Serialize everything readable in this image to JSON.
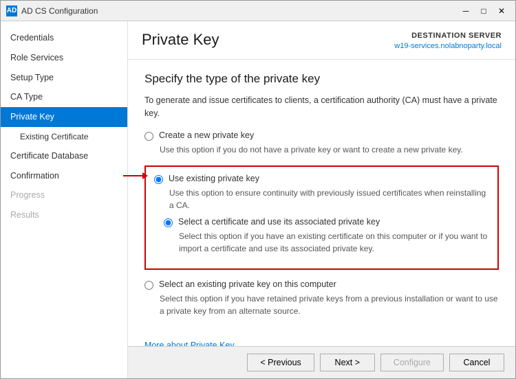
{
  "window": {
    "title": "AD CS Configuration",
    "icon": "AD"
  },
  "titlebar_controls": {
    "minimize": "─",
    "maximize": "□",
    "close": "✕"
  },
  "header": {
    "page_title": "Private Key",
    "destination_label": "DESTINATION SERVER",
    "server_name": "w19-services.nolabnoparty.local"
  },
  "sidebar": {
    "items": [
      {
        "label": "Credentials",
        "state": "normal"
      },
      {
        "label": "Role Services",
        "state": "normal"
      },
      {
        "label": "Setup Type",
        "state": "normal"
      },
      {
        "label": "CA Type",
        "state": "normal"
      },
      {
        "label": "Private Key",
        "state": "active"
      },
      {
        "label": "Existing Certificate",
        "state": "sub"
      },
      {
        "label": "Certificate Database",
        "state": "normal"
      },
      {
        "label": "Confirmation",
        "state": "normal"
      },
      {
        "label": "Progress",
        "state": "disabled"
      },
      {
        "label": "Results",
        "state": "disabled"
      }
    ]
  },
  "content": {
    "section_title": "Specify the type of the private key",
    "intro_text": "To generate and issue certificates to clients, a certification authority (CA) must have a private key.",
    "options": [
      {
        "id": "opt1",
        "label": "Create a new private key",
        "desc": "Use this option if you do not have a private key or want to create a new private key.",
        "checked": false,
        "highlighted": false
      },
      {
        "id": "opt2",
        "label": "Use existing private key",
        "desc": "Use this option to ensure continuity with previously issued certificates when reinstalling a CA.",
        "checked": true,
        "highlighted": true,
        "sub_options": [
          {
            "id": "opt2a",
            "label": "Select a certificate and use its associated private key",
            "desc": "Select this option if you have an existing certificate on this computer or if you want to import a certificate and use its associated private key.",
            "checked": true
          },
          {
            "id": "opt2b",
            "label": "Select an existing private key on this computer",
            "desc": "Select this option if you have retained private keys from a previous installation or want to use a private key from an alternate source.",
            "checked": false
          }
        ]
      }
    ],
    "more_link": "More about Private Key"
  },
  "footer": {
    "previous_label": "< Previous",
    "next_label": "Next >",
    "configure_label": "Configure",
    "cancel_label": "Cancel"
  }
}
